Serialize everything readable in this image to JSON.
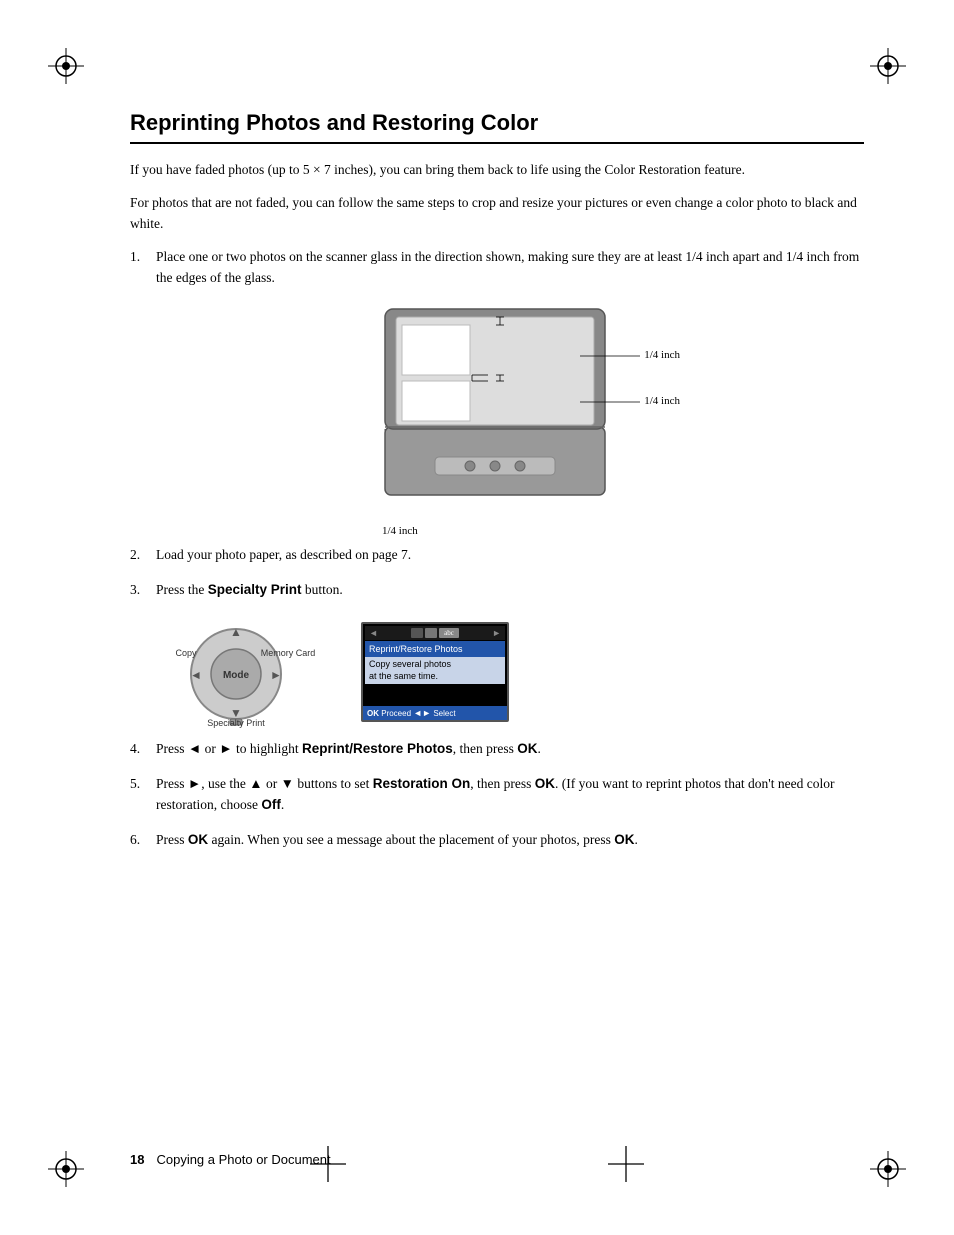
{
  "page": {
    "title": "Reprinting Photos and Restoring Color",
    "intro1": "If you have faded photos (up to 5 × 7 inches), you can bring them back to life using the Color Restoration feature.",
    "intro2": "For photos that are not faded, you can follow the same steps to crop and resize your pictures or even change a color photo to black and white.",
    "steps": [
      {
        "num": "1.",
        "text": "Place one or two photos on the scanner glass in the direction shown, making sure they are at least 1/4 inch apart and 1/4 inch from the edges of the glass."
      },
      {
        "num": "2.",
        "text": "Load your photo paper, as described on page 7."
      },
      {
        "num": "3.",
        "text": "Press the Specialty Print button."
      },
      {
        "num": "4.",
        "text": "Press ◄ or ► to highlight Reprint/Restore Photos, then press OK."
      },
      {
        "num": "5.",
        "text": "Press ►, use the ▲ or ▼ buttons to set Restoration On, then press OK. (If you want to reprint photos that don't need color restoration, choose Off."
      },
      {
        "num": "6.",
        "text": "Press OK again. When you see a message about the placement of your photos, press OK."
      }
    ],
    "dim_labels": [
      "1/4 inch",
      "1/4 inch",
      "1/4 inch"
    ],
    "dial_labels": {
      "copy": "Copy",
      "mode": "Mode",
      "memory_card": "Memory Card",
      "specialty_print": "Specialty Print"
    },
    "lcd": {
      "menu_item1": "Reprint/Restore Photos",
      "menu_item2_line1": "Copy several photos",
      "menu_item2_line2": "at the same time.",
      "bottom_bar": "OK Proceed    Select"
    },
    "footer": {
      "page_num": "18",
      "text": "Copying a Photo or Document"
    },
    "step3_bold": "Specialty Print",
    "step4_highlight": "Reprint/Restore Photos",
    "step4_ok": "OK",
    "step5_restoration": "Restoration On",
    "step5_ok": "OK",
    "step5_off": "Off",
    "step6_ok1": "OK",
    "step6_ok2": "OK"
  }
}
